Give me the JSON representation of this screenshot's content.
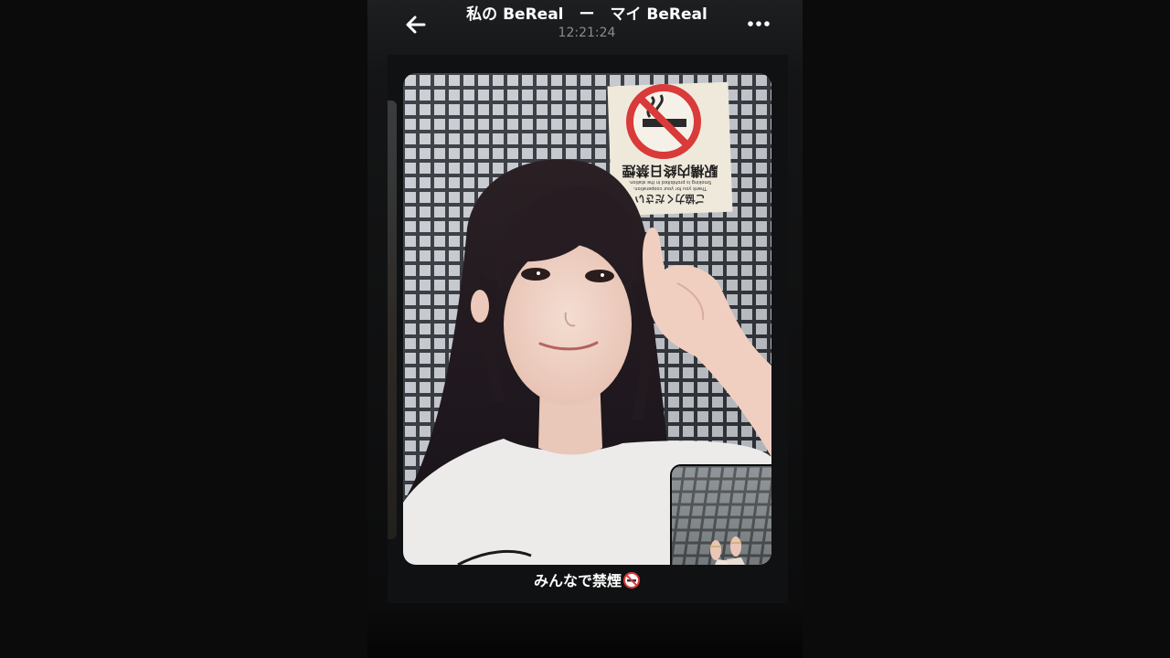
{
  "header": {
    "title": "私の BeReal　ー　マイ BeReal",
    "time": "12:21:24",
    "back_icon": "arrow-left-icon",
    "more_icon": "ellipsis-icon"
  },
  "photo": {
    "sign": {
      "line1": "駅構内終日禁煙",
      "line2": "Smoking is prohibited in the station.",
      "line3": "Thank you for your cooperation.",
      "line4": "ご協力ください"
    }
  },
  "caption": {
    "text": "みんなで禁煙",
    "emoji_icon": "no-smoking-icon"
  },
  "colors": {
    "background": "#0b0b0b",
    "phone": "#141516",
    "text_primary": "#ffffff",
    "text_secondary": "#8a8c8f"
  }
}
